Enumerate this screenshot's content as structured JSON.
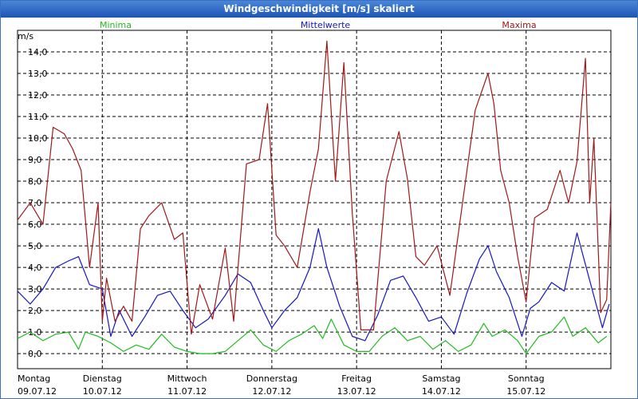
{
  "window": {
    "title": "Windgeschwindigkeit [m/s] skaliert"
  },
  "chart_data": {
    "type": "line",
    "title": "Windgeschwindigkeit [m/s] skaliert",
    "ylabel": "m/s",
    "ylim": [
      -0.7,
      15.0
    ],
    "xlim": [
      0,
      7
    ],
    "yticks": [
      "0,0",
      "1,0",
      "2,0",
      "3,0",
      "4,0",
      "5,0",
      "6,0",
      "7,0",
      "8,0",
      "9,0",
      "10,0",
      "11,0",
      "12,0",
      "13,0",
      "14,0"
    ],
    "days": [
      {
        "name": "Montag",
        "date": "09.07.12"
      },
      {
        "name": "Dienstag",
        "date": "10.07.12"
      },
      {
        "name": "Mittwoch",
        "date": "11.07.12"
      },
      {
        "name": "Donnerstag",
        "date": "12.07.12"
      },
      {
        "name": "Freitag",
        "date": "13.07.12"
      },
      {
        "name": "Samstag",
        "date": "14.07.12"
      },
      {
        "name": "Sonntag",
        "date": "15.07.12"
      }
    ],
    "grid": true,
    "series": [
      {
        "name": "Minima",
        "color": "#22bb22",
        "x": [
          0,
          0.15,
          0.3,
          0.45,
          0.6,
          0.72,
          0.8,
          0.95,
          1.1,
          1.25,
          1.4,
          1.55,
          1.7,
          1.85,
          2.0,
          2.15,
          2.3,
          2.45,
          2.6,
          2.75,
          2.9,
          3.05,
          3.2,
          3.35,
          3.5,
          3.6,
          3.7,
          3.85,
          4.0,
          4.15,
          4.3,
          4.45,
          4.6,
          4.75,
          4.9,
          5.05,
          5.2,
          5.35,
          5.5,
          5.6,
          5.75,
          5.9,
          6.0,
          6.15,
          6.3,
          6.45,
          6.55,
          6.7,
          6.85,
          6.95
        ],
        "values": [
          0.7,
          1.0,
          0.6,
          0.9,
          1.0,
          0.2,
          1.0,
          0.8,
          0.5,
          0.1,
          0.4,
          0.2,
          0.9,
          0.3,
          0.1,
          0.0,
          0.0,
          0.1,
          0.6,
          1.1,
          0.4,
          0.1,
          0.6,
          0.9,
          1.3,
          0.7,
          1.6,
          0.4,
          0.1,
          0.1,
          0.8,
          1.2,
          0.6,
          0.8,
          0.2,
          0.6,
          0.1,
          0.4,
          1.4,
          0.8,
          1.1,
          0.6,
          0.0,
          0.8,
          1.0,
          1.7,
          0.8,
          1.2,
          0.5,
          0.8
        ]
      },
      {
        "name": "Mittelwerte",
        "color": "#1515c0",
        "x": [
          0,
          0.15,
          0.3,
          0.45,
          0.6,
          0.72,
          0.85,
          1.0,
          1.1,
          1.2,
          1.35,
          1.5,
          1.65,
          1.8,
          1.95,
          2.1,
          2.25,
          2.45,
          2.6,
          2.75,
          2.9,
          3.0,
          3.15,
          3.3,
          3.45,
          3.55,
          3.65,
          3.8,
          3.95,
          4.1,
          4.25,
          4.4,
          4.55,
          4.7,
          4.85,
          5.0,
          5.15,
          5.3,
          5.45,
          5.55,
          5.65,
          5.8,
          5.95,
          6.05,
          6.15,
          6.3,
          6.45,
          6.6,
          6.75,
          6.9,
          6.98
        ],
        "values": [
          2.9,
          2.3,
          3.0,
          4.0,
          4.3,
          4.5,
          3.2,
          3.0,
          0.8,
          2.0,
          0.8,
          1.7,
          2.7,
          2.9,
          2.0,
          1.2,
          1.6,
          2.7,
          3.7,
          3.3,
          2.0,
          1.2,
          2.0,
          2.6,
          4.0,
          5.8,
          4.0,
          2.2,
          0.8,
          0.6,
          1.8,
          3.4,
          3.6,
          2.6,
          1.5,
          1.7,
          0.9,
          2.8,
          4.4,
          5.0,
          3.8,
          2.6,
          0.8,
          2.1,
          2.4,
          3.3,
          2.9,
          5.6,
          3.4,
          1.2,
          2.3
        ]
      },
      {
        "name": "Maxima",
        "color": "#a01818",
        "x": [
          0,
          0.15,
          0.3,
          0.42,
          0.55,
          0.65,
          0.75,
          0.85,
          0.95,
          1.0,
          1.05,
          1.15,
          1.25,
          1.35,
          1.45,
          1.55,
          1.7,
          1.85,
          1.95,
          2.05,
          2.15,
          2.3,
          2.45,
          2.55,
          2.7,
          2.85,
          2.95,
          3.05,
          3.15,
          3.3,
          3.45,
          3.55,
          3.65,
          3.75,
          3.85,
          3.95,
          4.05,
          4.2,
          4.35,
          4.5,
          4.6,
          4.7,
          4.8,
          4.95,
          5.1,
          5.25,
          5.4,
          5.55,
          5.62,
          5.7,
          5.8,
          5.9,
          6.0,
          6.1,
          6.25,
          6.4,
          6.5,
          6.6,
          6.7,
          6.75,
          6.8,
          6.88,
          6.95,
          7.0
        ],
        "values": [
          6.2,
          7.0,
          6.0,
          10.5,
          10.2,
          9.5,
          8.5,
          4.0,
          7.0,
          1.5,
          3.5,
          1.5,
          2.2,
          1.5,
          5.8,
          6.4,
          7.0,
          5.3,
          5.6,
          0.9,
          3.2,
          1.6,
          4.9,
          1.5,
          8.8,
          9.0,
          11.6,
          5.5,
          5.0,
          4.0,
          7.5,
          9.5,
          14.5,
          8.0,
          13.5,
          6.5,
          1.1,
          1.1,
          8.0,
          10.3,
          8.1,
          4.5,
          4.1,
          5.0,
          2.7,
          7.0,
          11.3,
          13.0,
          11.6,
          8.5,
          7.0,
          4.5,
          2.4,
          6.3,
          6.7,
          8.5,
          7.0,
          8.9,
          13.7,
          7.0,
          10.0,
          1.9,
          2.5,
          7.0
        ]
      }
    ]
  }
}
